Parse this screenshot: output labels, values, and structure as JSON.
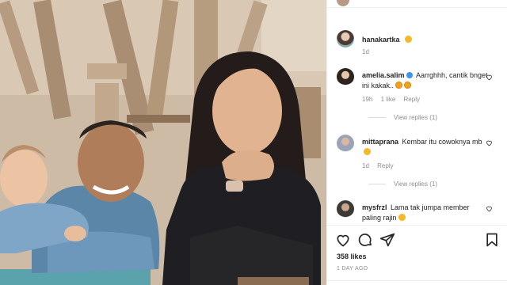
{
  "post": {
    "author": {
      "username": "hanakartka",
      "caption_emoji": "smiling-face-icon",
      "time": "1d"
    },
    "comments": [
      {
        "username": "amelia.salim",
        "verified": true,
        "text": "Aarrghhh, cantik bnget ini kakak..",
        "emoji": "heart-eyes-icon",
        "time": "19h",
        "likes": "1 like",
        "reply": "Reply",
        "view_replies": "View replies (1)"
      },
      {
        "username": "mittaprana",
        "verified": false,
        "text": "Kembar itu cowoknya mb",
        "emoji": "laughing-face-icon",
        "time": "1d",
        "reply": "Reply",
        "view_replies": "View replies (1)"
      },
      {
        "username": "mysfrzl",
        "verified": false,
        "text": "Lama tak jumpa member paling rajin",
        "emoji": "crying-face-icon"
      }
    ],
    "likes": "358 likes",
    "posted_ago": "1 DAY AGO"
  },
  "colors": {
    "link_gray": "#8e8e8e",
    "text": "#262626",
    "verified_blue": "#3897f0",
    "border": "#efefef"
  },
  "icons": [
    "heart-icon",
    "comment-icon",
    "share-icon",
    "bookmark-icon"
  ]
}
